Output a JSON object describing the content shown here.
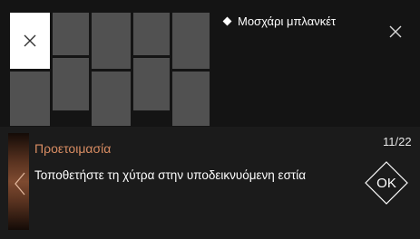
{
  "header": {
    "dish_title": "Μοσχάρι μπλανκέτ",
    "diamond_icon": "diamond-icon",
    "close_icon": "close-icon"
  },
  "thumbnails": {
    "count": 10,
    "selected_index": 0,
    "selected_icon": "close-icon"
  },
  "step": {
    "label": "Προετοιμασία",
    "counter": "11/22",
    "instruction": "Τοποθετήστε τη χύτρα στην υποδεικνυόμενη εστία",
    "prev_icon": "chevron-left-icon",
    "ok_label": "OK"
  },
  "colors": {
    "accent": "#d98d63",
    "cell": "#515151",
    "selected_cell": "#ffffff"
  }
}
